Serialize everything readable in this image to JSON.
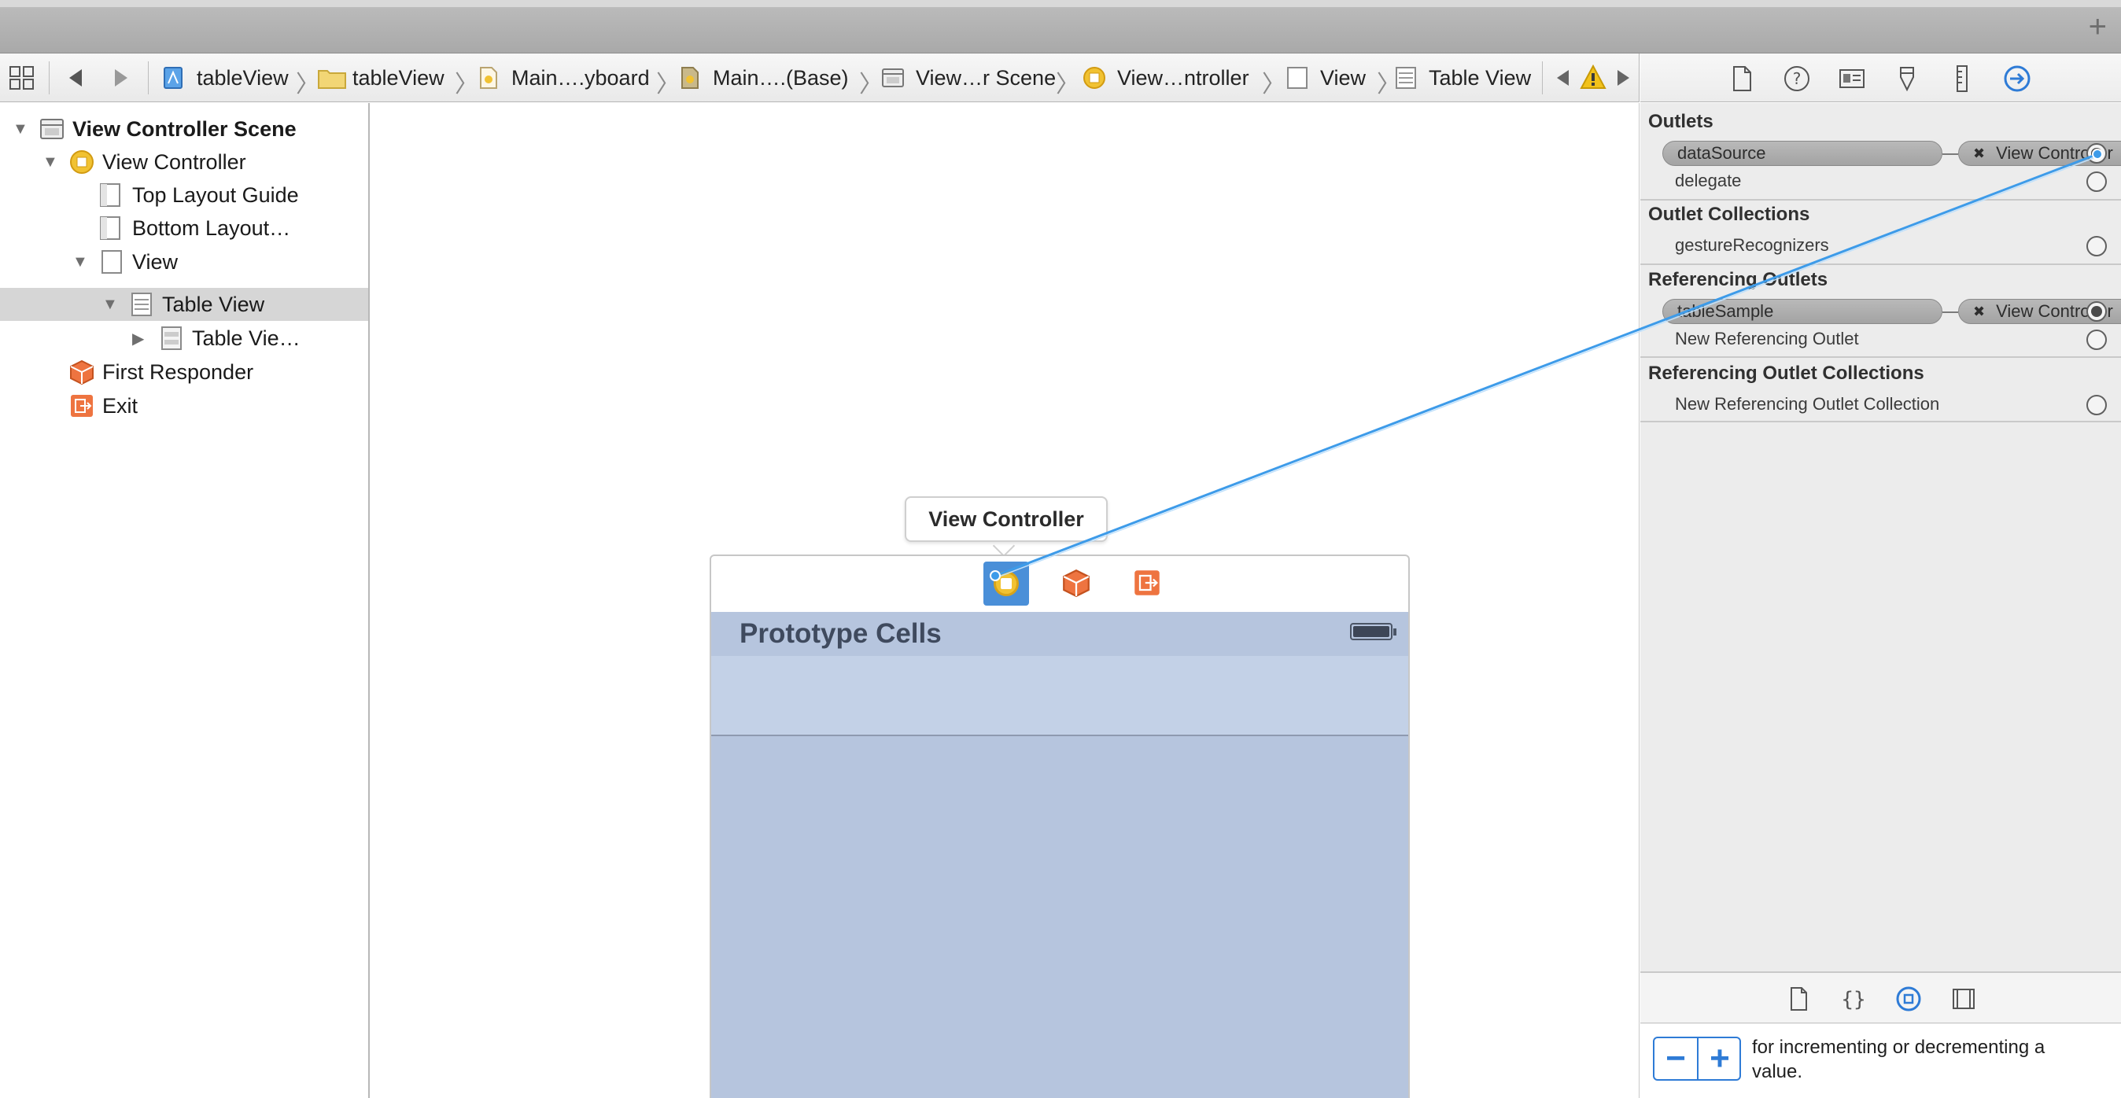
{
  "window": {
    "add_tab_label": "+"
  },
  "jumpbar": {
    "crumbs": [
      {
        "label": "tableView",
        "icon": "project-icon"
      },
      {
        "label": "tableView",
        "icon": "folder-icon"
      },
      {
        "label": "Main….yboard",
        "icon": "storyboard-icon"
      },
      {
        "label": "Main….(Base)",
        "icon": "storyboard-base-icon"
      },
      {
        "label": "View…r Scene",
        "icon": "scene-icon"
      },
      {
        "label": "View…ntroller",
        "icon": "view-controller-icon"
      },
      {
        "label": "View",
        "icon": "view-icon"
      },
      {
        "label": "Table View",
        "icon": "table-view-icon"
      }
    ]
  },
  "navigator": {
    "items": [
      {
        "label": "View Controller Scene",
        "icon": "scene-icon",
        "bold": true
      },
      {
        "label": "View Controller",
        "icon": "view-controller-icon"
      },
      {
        "label": "Top Layout Guide",
        "icon": "layout-guide-icon"
      },
      {
        "label": "Bottom Layout…",
        "icon": "layout-guide-icon"
      },
      {
        "label": "View",
        "icon": "view-icon"
      },
      {
        "label": "Table View",
        "icon": "table-view-icon",
        "selected": true
      },
      {
        "label": "Table Vie…",
        "icon": "table-view-cell-icon"
      },
      {
        "label": "First Responder",
        "icon": "first-responder-icon"
      },
      {
        "label": "Exit",
        "icon": "exit-icon"
      }
    ]
  },
  "canvas": {
    "tooltip": "View Controller",
    "prototype_title": "Prototype Cells"
  },
  "inspector": {
    "outlets": {
      "title": "Outlets",
      "rows": [
        {
          "label": "dataSource",
          "connected_to": "View Controller"
        },
        {
          "label": "delegate"
        }
      ]
    },
    "outlet_collections": {
      "title": "Outlet Collections",
      "rows": [
        {
          "label": "gestureRecognizers"
        }
      ]
    },
    "referencing_outlets": {
      "title": "Referencing Outlets",
      "rows": [
        {
          "label": "tableSample",
          "connected_to": "View Controller"
        },
        {
          "label": "New Referencing Outlet"
        }
      ]
    },
    "referencing_outlet_collections": {
      "title": "Referencing Outlet Collections",
      "rows": [
        {
          "label": "New Referencing Outlet Collection"
        }
      ]
    }
  },
  "library": {
    "stepper_minus": "−",
    "stepper_plus": "+",
    "description": "for incrementing or decrementing a value."
  },
  "colors": {
    "accent": "#2e7bd6",
    "connection_line": "#3d9be9",
    "selection": "#d6d6d6"
  }
}
